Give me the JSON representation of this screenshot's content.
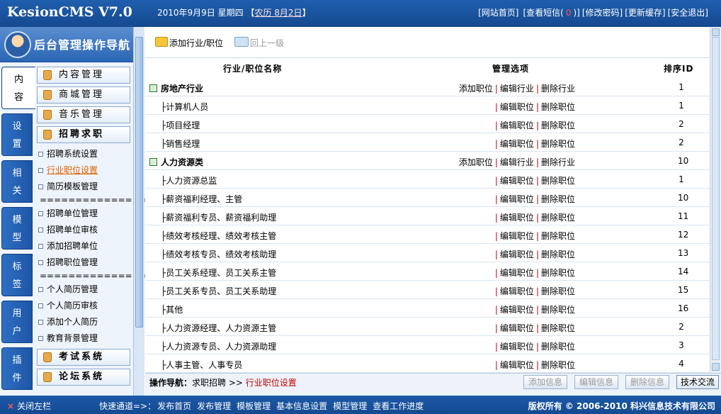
{
  "header": {
    "logo": "KesionCMS V7.0",
    "date": "2010年9月9日 星期四",
    "lunar_open": "【",
    "lunar": "农历 8月2日",
    "lunar_close": "】",
    "links": [
      "[网站首页]",
      "[查看短信(",
      "0",
      ")]",
      "[修改密码]",
      "[更新缓存]",
      "[安全退出]"
    ]
  },
  "sidebar": {
    "title": "后台管理操作导航",
    "tabs": [
      "内容",
      "设置",
      "相关",
      "模型",
      "标签",
      "用户",
      "插件"
    ],
    "active_tab": "内容",
    "groups": [
      "内容管理",
      "商城管理",
      "音乐管理",
      "招聘求职"
    ],
    "sub_items_a": [
      "招聘系统设置",
      "行业职位设置",
      "简历模板管理"
    ],
    "separator": "==================",
    "sub_items_b": [
      "招聘单位管理",
      "招聘单位审核",
      "添加招聘单位",
      "招聘职位管理"
    ],
    "sub_items_c": [
      "个人简历管理",
      "个人简历审核",
      "添加个人简历",
      "教育背景管理"
    ],
    "bottom_groups": [
      "考试系统",
      "论坛系统"
    ]
  },
  "toolbar": {
    "add_label": "添加行业/职位",
    "back_label": "回上一级"
  },
  "table": {
    "headers": {
      "name": "行业/职位名称",
      "ops": "管理选项",
      "id": "排序ID"
    },
    "rows": [
      {
        "name": "房地产行业",
        "type": "parent",
        "ops": [
          "添加职位",
          "编辑行业",
          "删除行业"
        ],
        "id": "1"
      },
      {
        "name": "├计算机人员",
        "type": "child",
        "ops": [
          "编辑职位",
          "删除职位"
        ],
        "id": "1"
      },
      {
        "name": "├项目经理",
        "type": "child",
        "ops": [
          "编辑职位",
          "删除职位"
        ],
        "id": "2"
      },
      {
        "name": "├销售经理",
        "type": "child",
        "ops": [
          "编辑职位",
          "删除职位"
        ],
        "id": "2"
      },
      {
        "name": "人力资源类",
        "type": "parent",
        "ops": [
          "添加职位",
          "编辑行业",
          "删除行业"
        ],
        "id": "10"
      },
      {
        "name": "├人力资源总监",
        "type": "child",
        "ops": [
          "编辑职位",
          "删除职位"
        ],
        "id": "1"
      },
      {
        "name": "├薪资福利经理、主管",
        "type": "child",
        "ops": [
          "编辑职位",
          "删除职位"
        ],
        "id": "10"
      },
      {
        "name": "├薪资福利专员、薪资福利助理",
        "type": "child",
        "ops": [
          "编辑职位",
          "删除职位"
        ],
        "id": "11"
      },
      {
        "name": "├绩效考核经理、绩效考核主管",
        "type": "child",
        "ops": [
          "编辑职位",
          "删除职位"
        ],
        "id": "12"
      },
      {
        "name": "├绩效考核专员、绩效考核助理",
        "type": "child",
        "ops": [
          "编辑职位",
          "删除职位"
        ],
        "id": "13"
      },
      {
        "name": "├员工关系经理、员工关系主管",
        "type": "child",
        "ops": [
          "编辑职位",
          "删除职位"
        ],
        "id": "14"
      },
      {
        "name": "├员工关系专员、员工关系助理",
        "type": "child",
        "ops": [
          "编辑职位",
          "删除职位"
        ],
        "id": "15"
      },
      {
        "name": "├其他",
        "type": "child",
        "ops": [
          "编辑职位",
          "删除职位"
        ],
        "id": "16"
      },
      {
        "name": "├人力资源经理、人力资源主管",
        "type": "child",
        "ops": [
          "编辑职位",
          "删除职位"
        ],
        "id": "2"
      },
      {
        "name": "├人力资源专员、人力资源助理",
        "type": "child",
        "ops": [
          "编辑职位",
          "删除职位"
        ],
        "id": "3"
      },
      {
        "name": "├人事主管、人事专员",
        "type": "child",
        "ops": [
          "编辑职位",
          "删除职位"
        ],
        "id": "4"
      }
    ],
    "separator": "|"
  },
  "footer": {
    "crumb_label": "操作导航：",
    "crumb_parent": "求职招聘",
    "crumb_arrow": ">>",
    "crumb_current": "行业职位设置",
    "buttons": [
      "添加信息",
      "编辑信息",
      "删除信息",
      "技术交流"
    ]
  },
  "bottom_bar": {
    "close": "关闭左栏",
    "close_icon": "×",
    "quick_label": "快速通道=>：",
    "quick_links": [
      "发布首页",
      "发布管理",
      "模板管理",
      "基本信息设置",
      "模型管理",
      "查看工作进度"
    ],
    "copyright": "版权所有 © 2006-2010 科兴信息技术有限公司"
  }
}
